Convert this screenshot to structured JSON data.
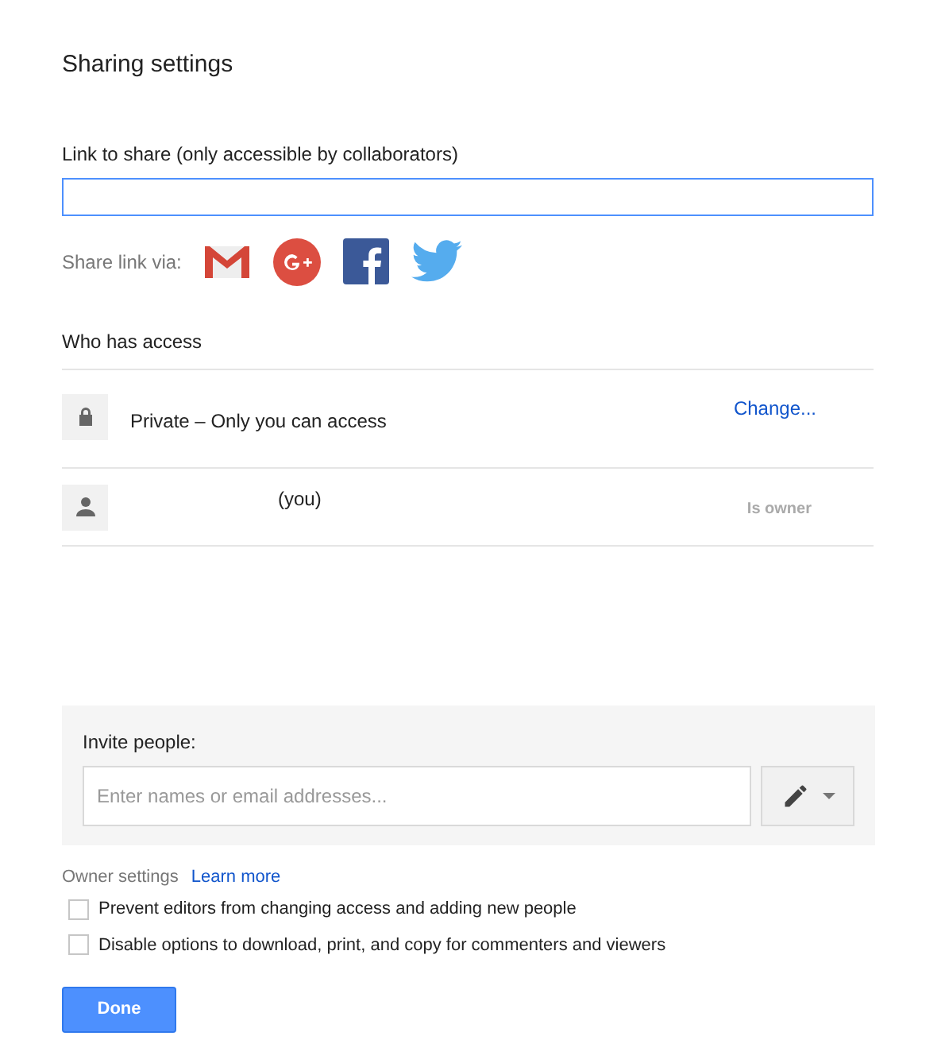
{
  "title": "Sharing settings",
  "link": {
    "label": "Link to share (only accessible by collaborators)"
  },
  "share_via": {
    "label": "Share link via:",
    "services": [
      {
        "kind": "gmail"
      },
      {
        "kind": "googleplus"
      },
      {
        "kind": "facebook"
      },
      {
        "kind": "twitter"
      }
    ]
  },
  "access": {
    "heading": "Who has access",
    "rows": [
      {
        "kind": "lock",
        "text": "Private – Only you can access",
        "action": "Change..."
      },
      {
        "kind": "person",
        "text": "(you)",
        "role": "Is owner"
      }
    ]
  },
  "invite": {
    "label": "Invite people:",
    "placeholder": "Enter names or email addresses..."
  },
  "owner_settings": {
    "label": "Owner settings",
    "link": "Learn more",
    "options": [
      {
        "text": "Prevent editors from changing access and adding new people",
        "checked": false
      },
      {
        "text": "Disable options to download, print, and copy for commenters and viewers",
        "checked": false
      }
    ]
  },
  "done": "Done"
}
